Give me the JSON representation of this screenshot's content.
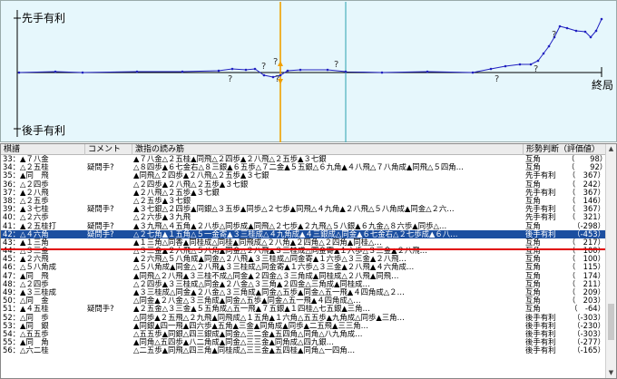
{
  "graph": {
    "label_sente": "先手有利",
    "label_gote": "後手有利",
    "label_end": "終局",
    "question_marks": [
      "?",
      "?",
      "?",
      "?",
      "?",
      "?",
      "?",
      "?"
    ],
    "colors": {
      "line": "#2020c0",
      "cursor": "#f0a000",
      "bg": "#e6f7fc"
    }
  },
  "table": {
    "headers": [
      "棋譜",
      "コメント",
      "激指の読み筋",
      "形勢判断（評価値）"
    ],
    "rows": [
      {
        "move": "33：▲７八金",
        "comment": "",
        "pv": "▲７八金△２五桂▲同飛△２四歩▲２八飛△２五歩▲３七銀",
        "judge": "互角",
        "value": "（　　98）"
      },
      {
        "move": "34：△２五桂",
        "comment": "疑問手?",
        "pv": "△８四歩▲６七金右△８三銀▲６五歩△７二金▲５五銀△６九角▲４八飛△７八角成▲同飛△５四角…",
        "judge": "互角",
        "value": "（　　92）"
      },
      {
        "move": "35：▲同　飛",
        "comment": "",
        "pv": "▲同飛△２四歩▲２八飛△２五歩▲３七銀",
        "judge": "先手有利",
        "value": "（　367）"
      },
      {
        "move": "36：△２四歩",
        "comment": "",
        "pv": "△２四歩▲２八飛△２五歩▲３七銀",
        "judge": "互角",
        "value": "（　242）"
      },
      {
        "move": "37：▲２八飛",
        "comment": "",
        "pv": "▲２八飛△２五歩▲３七銀",
        "judge": "先手有利",
        "value": "（　367）"
      },
      {
        "move": "38：△２五歩",
        "comment": "",
        "pv": "△２五歩▲３七銀",
        "judge": "互角",
        "value": "（　146）"
      },
      {
        "move": "39：▲３七桂",
        "comment": "疑問手?",
        "pv": "▲３七銀△２四歩▲同銀△３五歩▲同歩△２七歩▲同飛△４九角▲２八飛△５八角成▲同金△２六…",
        "judge": "先手有利",
        "value": "（　367）"
      },
      {
        "move": "40：△２六歩",
        "comment": "",
        "pv": "△２六歩▲３九飛",
        "judge": "先手有利",
        "value": "（　321）"
      },
      {
        "move": "41：▲２五桂打",
        "comment": "疑問手?",
        "pv": "▲３九飛△４五角▲２八歩△同歩成▲同飛△２七歩▲２九飛△５八銀▲６九金△８六歩▲同歩△…",
        "judge": "互角",
        "value": "（-298）"
      },
      {
        "move": "42：△４六角",
        "comment": "疑問手?",
        "pv": "△２七角▲１五角△５一金寄▲３三桂成△４九角成▲４三銀成△同金▲６七金右△２七歩成▲６八…",
        "judge": "後手有利",
        "value": "（-453）"
      },
      {
        "move": "43：▲１三角",
        "comment": "",
        "pv": "▲１三角△同香▲同桂成△同桂▲同飛成△２八角▲２四角△２四角▲同桂△…",
        "judge": "互角",
        "value": "（　217）"
      },
      {
        "move": "44：△３三金",
        "comment": "",
        "pv": "△３三金▲２六飛△５八角▲同金△２八飛▲３三桂成△同金寄▲１六歩△３三金▲２八飛…",
        "judge": "互角",
        "value": "（　100）"
      },
      {
        "move": "45：▲２六飛",
        "comment": "",
        "pv": "▲２六飛△５八角成▲同金△２八飛▲３三桂成△同金寄▲１六歩△３三金▲２八飛…",
        "judge": "互角",
        "value": "（　100）"
      },
      {
        "move": "46：△５八角成",
        "comment": "",
        "pv": "△５八角成▲同金△２八飛▲３三桂成△同金寄▲１六歩△３三金▲２八飛▲４六角成…",
        "judge": "互角",
        "value": "（　115）"
      },
      {
        "move": "47：▲同　飛",
        "comment": "",
        "pv": "▲同飛△２八飛▲３三桂不成△同金▲２四金△３三角成▲同桂成△２八飛▲同飛…",
        "judge": "互角",
        "value": "（　174）"
      },
      {
        "move": "48：△２四歩",
        "comment": "",
        "pv": "△２四歩▲３三桂成△同金▲２八金△３三角▲２四金△三角成▲同桂成…",
        "judge": "互角",
        "value": "（　211）"
      },
      {
        "move": "49：▲３三桂成",
        "comment": "",
        "pv": "▲３三桂成△同金▲２八金△３三角成▲同金△五歩▲同金△五一飛▲４四角成△２…",
        "judge": "互角",
        "value": "（　209）"
      },
      {
        "move": "50：△同　金",
        "comment": "",
        "pv": "△同金▲２八金△３三角成▲同金△五歩▲同金△五一飛▲４四角成△…",
        "judge": "互角",
        "value": "（　203）"
      },
      {
        "move": "51：▲４五桂",
        "comment": "疑問手?",
        "pv": "▲２五金△３三金▲５五角成△五一飛▲７五銀▲１四桂△七五銀▲三角…",
        "judge": "互角",
        "value": "（　-64）"
      },
      {
        "move": "52：△同　歩",
        "comment": "",
        "pv": "△同歩▲２五飛△２九飛▲同飛成△１五角▲１六角△五五歩▲九角成△同歩▲三角…",
        "judge": "後手有利",
        "value": "（-303）"
      },
      {
        "move": "53：▲同　銀",
        "comment": "",
        "pv": "▲同銀▲四一飛▲四六歩▲五角▲三金▲同角成▲同歩▲二五飛▲三三角…",
        "judge": "後手有利",
        "value": "（-230）"
      },
      {
        "move": "54：△五五歩",
        "comment": "",
        "pv": "△五五歩▲同銀△四三銀成▲同金△三二金▲五四角△同角△八九角成…",
        "judge": "後手有利",
        "value": "（-303）"
      },
      {
        "move": "55：▲同　角",
        "comment": "",
        "pv": "▲同角△五四歩▲八二角成▲同金△三三金▲同角成△四九銀…",
        "judge": "後手有利",
        "value": "（-277）"
      },
      {
        "move": "56：△六二桂",
        "comment": "",
        "pv": "△二五歩▲同飛△四三角▲同桂成△三三金▲五四桂▲同角△一四角…",
        "judge": "後手有利",
        "value": "（-165）"
      }
    ]
  }
}
